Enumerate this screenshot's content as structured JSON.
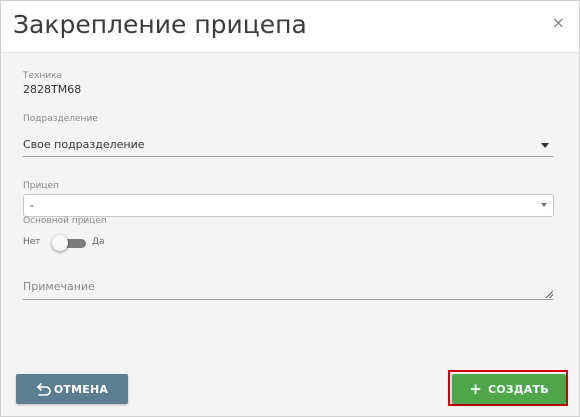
{
  "dialog": {
    "title": "Закрепление прицепа",
    "close_glyph": "×"
  },
  "form": {
    "vehicle": {
      "label": "Техника",
      "value": "2828TM68"
    },
    "division": {
      "label": "Подразделение",
      "value": "Свое подразделение"
    },
    "trailer": {
      "label": "Прицеп",
      "value": "-"
    },
    "main_trailer": {
      "label": "Основной прицеп",
      "off_label": "Нет",
      "on_label": "Да",
      "checked": false
    },
    "note": {
      "placeholder": "Примечание"
    }
  },
  "buttons": {
    "cancel": {
      "label": "ОТМЕНА",
      "icon": "undo-icon",
      "color": "#5b7f91"
    },
    "create": {
      "label": "СОЗДАТЬ",
      "icon": "plus-icon",
      "color": "#4ea84b"
    }
  }
}
